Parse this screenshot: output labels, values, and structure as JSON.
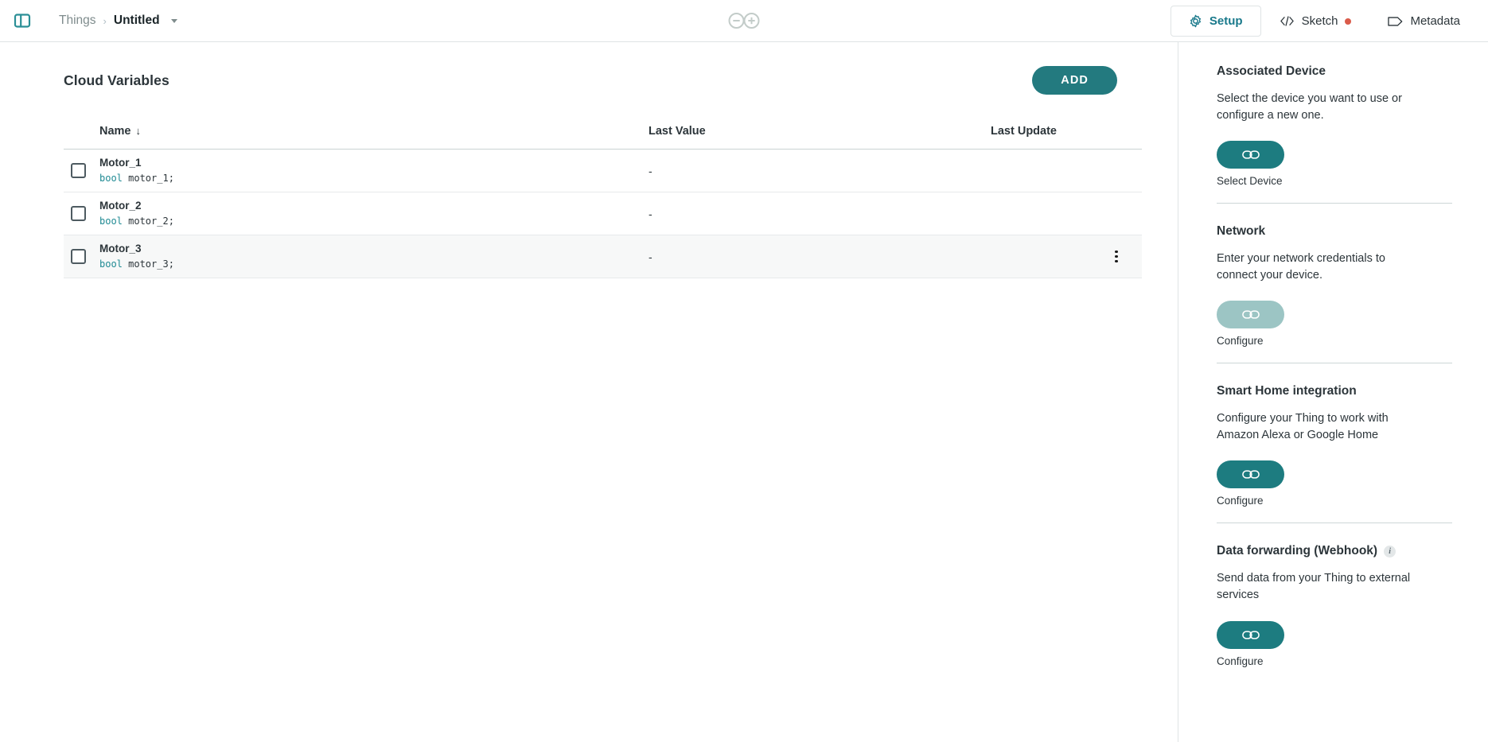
{
  "header": {
    "panel_toggle_icon": "sidebar-panel-icon",
    "breadcrumb": {
      "root": "Things",
      "separator": "›",
      "current": "Untitled"
    },
    "logo_icon": "arduino-infinity-logo",
    "tabs": [
      {
        "label": "Setup",
        "icon": "gear-icon",
        "active": true,
        "dot": false
      },
      {
        "label": "Sketch",
        "icon": "code-brackets-icon",
        "active": false,
        "dot": true
      },
      {
        "label": "Metadata",
        "icon": "tag-icon",
        "active": false,
        "dot": false
      }
    ],
    "dot_color": "#da5b4a"
  },
  "main": {
    "title": "Cloud Variables",
    "add_label": "ADD",
    "table": {
      "columns": [
        "Name",
        "Last Value",
        "Last Update"
      ],
      "sort_indicator": "↓",
      "rows": [
        {
          "name": "Motor_1",
          "type": "bool",
          "declaration": " motor_1;",
          "last_value": "-",
          "last_update": "",
          "checked": false,
          "hovered": false
        },
        {
          "name": "Motor_2",
          "type": "bool",
          "declaration": " motor_2;",
          "last_value": "-",
          "last_update": "",
          "checked": false,
          "hovered": false
        },
        {
          "name": "Motor_3",
          "type": "bool",
          "declaration": " motor_3;",
          "last_value": "-",
          "last_update": "",
          "checked": false,
          "hovered": true
        }
      ]
    }
  },
  "sidebar": {
    "sections": [
      {
        "title": "Associated Device",
        "description": "Select the device you want to use or configure a new one.",
        "button_icon": "link-icon",
        "button_caption": "Select Device",
        "button_state": "enabled",
        "info": false
      },
      {
        "title": "Network",
        "description": "Enter your network credentials to connect your device.",
        "button_icon": "link-icon",
        "button_caption": "Configure",
        "button_state": "muted",
        "info": false
      },
      {
        "title": "Smart Home integration",
        "description": "Configure your Thing to work with Amazon Alexa or Google Home",
        "button_icon": "link-icon",
        "button_caption": "Configure",
        "button_state": "enabled",
        "info": false
      },
      {
        "title": "Data forwarding (Webhook)",
        "description": "Send data from your Thing to external services",
        "button_icon": "link-icon",
        "button_caption": "Configure",
        "button_state": "enabled",
        "info": true,
        "info_label": "i"
      }
    ]
  },
  "colors": {
    "accent_teal": "#1d7c80",
    "accent_teal_muted": "#9cc5c4",
    "add_button": "#237a7f",
    "tab_active_text": "#19798b",
    "code_keyword": "#1f8a93",
    "row_hover": "#f7f8f8",
    "border": "#dfe4e5"
  }
}
